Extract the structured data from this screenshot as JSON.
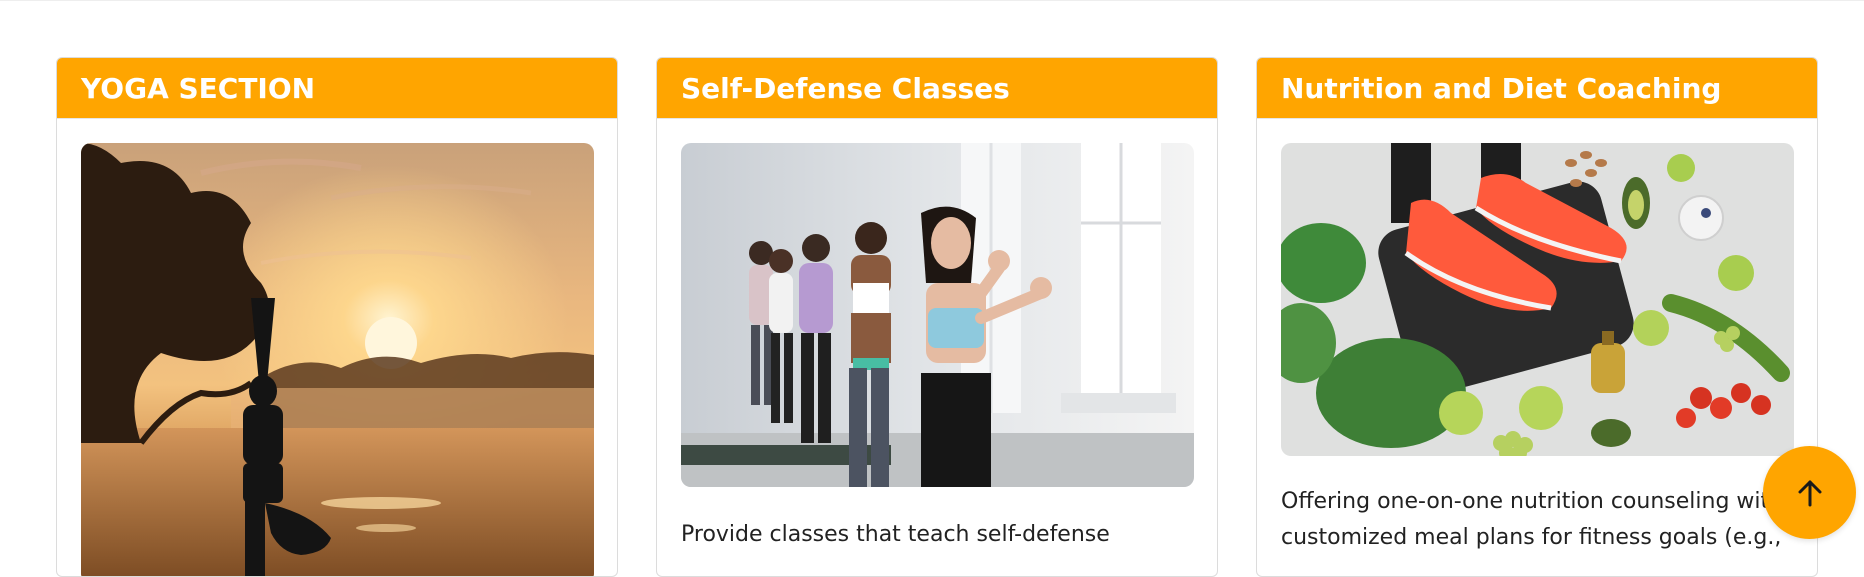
{
  "cards": [
    {
      "title": "YOGA SECTION",
      "image_alt": "Woman in yoga tree pose by a lake at sunrise",
      "text": ""
    },
    {
      "title": "Self-Defense Classes",
      "image_alt": "Group of women in fighting stance in a bright studio",
      "text": "Provide classes that teach self-defense"
    },
    {
      "title": "Nutrition and Diet Coaching",
      "image_alt": "Person on a scale surrounded by healthy food",
      "text": "Offering one-on-one nutrition counseling with customized meal plans for fitness goals (e.g.,"
    }
  ],
  "back_to_top": {
    "icon": "arrow-up-icon"
  },
  "colors": {
    "accent": "#ffa500",
    "header_text": "#ffffff",
    "body_text": "#222222"
  }
}
